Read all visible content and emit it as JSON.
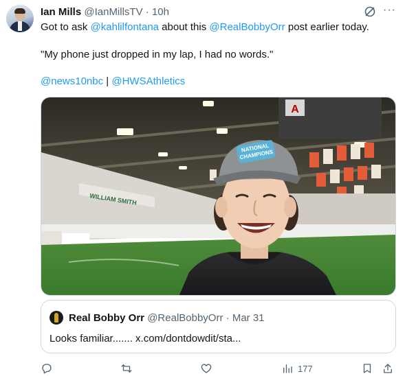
{
  "author": {
    "name": "Ian Mills",
    "handle": "@IanMillsTV",
    "separator": "·",
    "time": "10h"
  },
  "tweet": {
    "line1_prefix": "Got to ask ",
    "line1_mention1": "@kahlilfontana",
    "line1_middle": " about this ",
    "line1_mention2": "@RealBobbyOrr",
    "line1_suffix": " post earlier today.",
    "quote_line": "\"My phone just dropped in my lap, I had no words.\"",
    "tag1": "@news10nbc",
    "tag_separator": " | ",
    "tag2": "@HWSAthletics"
  },
  "media": {
    "description_icon": "video-thumbnail",
    "cap_text_line1": "NATIONAL",
    "cap_text_line2": "CHAMPIONS",
    "banner_text": "WILLIAM SMITH",
    "rink_letter": "A"
  },
  "quoted_tweet": {
    "name": "Real Bobby Orr",
    "handle": "@RealBobbyOrr",
    "separator": "·",
    "date": "Mar 31",
    "text": "Looks familiar....... x.com/dontdowdit/sta..."
  },
  "actions": {
    "views_count": "177"
  },
  "colors": {
    "link": "#1d9bf0",
    "text": "#0f1419",
    "muted": "#536471",
    "border": "#cfd9de"
  }
}
